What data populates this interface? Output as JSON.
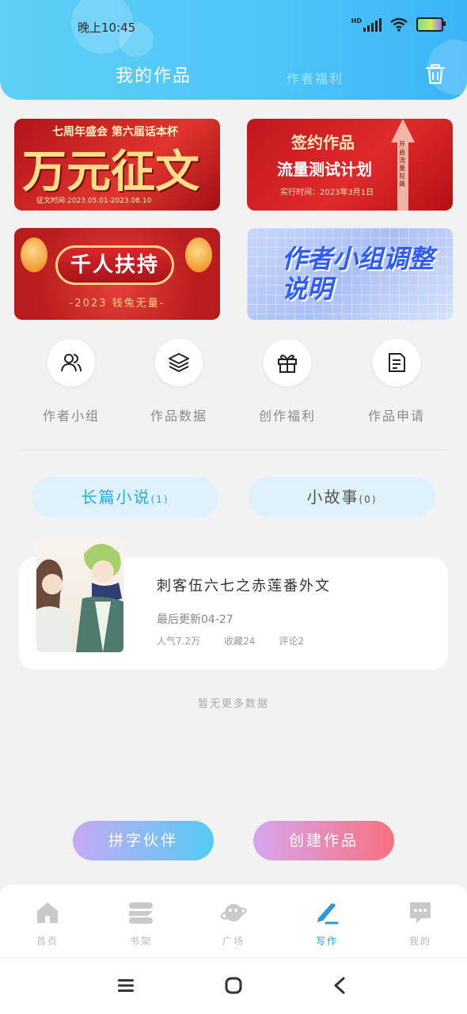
{
  "status_bar": {
    "time": "晚上10:45",
    "hd_label": "HD"
  },
  "header": {
    "tab_active": "我的作品",
    "tab_inactive": "作者福利",
    "delete_icon": "trash-icon"
  },
  "banners": [
    {
      "top_text": "七周年盛会  第六届话本杯",
      "main_text": "万元征文",
      "date_text": "征文时间:2023.05.01-2023.08.10"
    },
    {
      "line1": "签约作品",
      "line2": "流量测试计划",
      "line3": "实行时间：2023年3月1日",
      "arrow_text": "开启流量狂飙"
    },
    {
      "main_text": "千人扶持",
      "sub_text": "-2023 钱兔无量-"
    },
    {
      "main_text": "作者小组调整说明"
    }
  ],
  "quick_actions": [
    {
      "label": "作者小组",
      "icon": "users-icon"
    },
    {
      "label": "作品数据",
      "icon": "layers-icon"
    },
    {
      "label": "创作福利",
      "icon": "gift-icon"
    },
    {
      "label": "作品申请",
      "icon": "document-icon"
    }
  ],
  "segments": [
    {
      "label": "长篇小说",
      "count": "(1)"
    },
    {
      "label": "小故事",
      "count": "(0)"
    }
  ],
  "work": {
    "title": "刺客伍六七之赤莲番外文",
    "updated": "最后更新04-27",
    "popularity": "人气7.2万",
    "favorites": "收藏24",
    "comments": "评论2"
  },
  "no_more": "暂无更多数据",
  "buttons": {
    "partner": "拼字伙伴",
    "create": "创建作品"
  },
  "nav": [
    {
      "label": "首页",
      "icon": "home-icon"
    },
    {
      "label": "书架",
      "icon": "bookshelf-icon"
    },
    {
      "label": "广场",
      "icon": "planet-icon"
    },
    {
      "label": "写作",
      "icon": "pen-icon"
    },
    {
      "label": "我的",
      "icon": "chat-icon"
    }
  ],
  "colors": {
    "header": "#4cc5f7",
    "accent": "#2aa9e0",
    "nav_active": "#2b9ad6"
  }
}
